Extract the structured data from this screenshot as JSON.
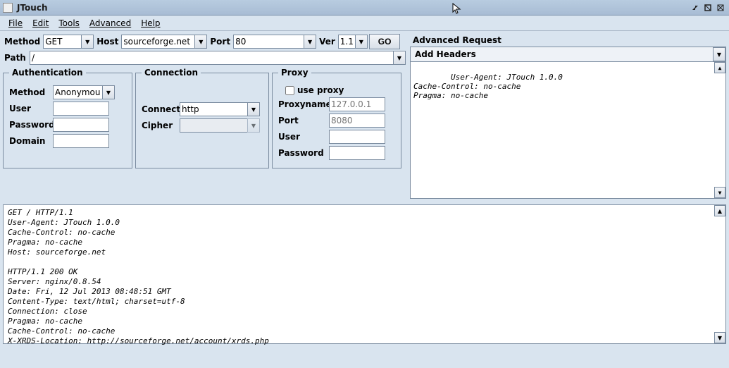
{
  "window": {
    "title": "JTouch"
  },
  "menubar": {
    "file": "File",
    "edit": "Edit",
    "tools": "Tools",
    "advanced": "Advanced",
    "help": "Help"
  },
  "request": {
    "method_label": "Method",
    "method_value": "GET",
    "host_label": "Host",
    "host_value": "sourceforge.net",
    "port_label": "Port",
    "port_value": "80",
    "ver_label": "Ver",
    "ver_value": "1.1",
    "go_label": "GO",
    "path_label": "Path",
    "path_value": "/"
  },
  "auth": {
    "legend": "Authentication",
    "method_label": "Method",
    "method_value": "Anonymous",
    "user_label": "User",
    "user_value": "",
    "password_label": "Password",
    "password_value": "",
    "domain_label": "Domain",
    "domain_value": ""
  },
  "conn": {
    "legend": "Connection",
    "connect_label": "Connect",
    "connect_value": "http",
    "cipher_label": "Cipher",
    "cipher_value": ""
  },
  "proxy": {
    "legend": "Proxy",
    "use_proxy_label": "use proxy",
    "proxyname_label": "Proxyname",
    "proxyname_placeholder": "127.0.0.1",
    "port_label": "Port",
    "port_placeholder": "8080",
    "user_label": "User",
    "user_value": "",
    "password_label": "Password",
    "password_value": ""
  },
  "advanced": {
    "title": "Advanced Request",
    "add_headers_label": "Add Headers",
    "headers_text": "User-Agent: JTouch 1.0.0\nCache-Control: no-cache\nPragma: no-cache"
  },
  "response": {
    "text": "GET / HTTP/1.1\nUser-Agent: JTouch 1.0.0\nCache-Control: no-cache\nPragma: no-cache\nHost: sourceforge.net\n\nHTTP/1.1 200 OK\nServer: nginx/0.8.54\nDate: Fri, 12 Jul 2013 08:48:51 GMT\nContent-Type: text/html; charset=utf-8\nConnection: close\nPragma: no-cache\nCache-Control: no-cache\nX-XRDS-Location: http://sourceforge.net/account/xrds.php"
  }
}
